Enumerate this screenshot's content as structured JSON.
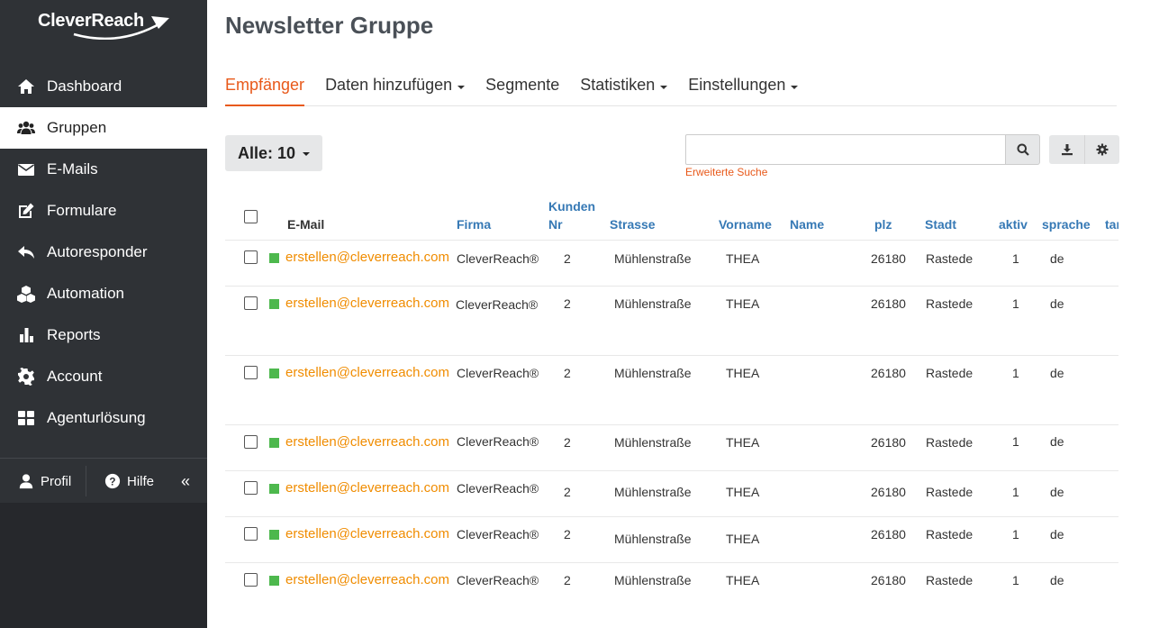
{
  "app": {
    "logo_text": "CleverReach"
  },
  "sidebar": {
    "items": [
      {
        "label": "Dashboard",
        "icon": "home-icon"
      },
      {
        "label": "Gruppen",
        "icon": "users-icon",
        "active": true
      },
      {
        "label": "E-Mails",
        "icon": "envelope-icon"
      },
      {
        "label": "Formulare",
        "icon": "edit-icon"
      },
      {
        "label": "Autoresponder",
        "icon": "reply-icon"
      },
      {
        "label": "Automation",
        "icon": "cubes-icon"
      },
      {
        "label": "Reports",
        "icon": "bar-chart-icon"
      },
      {
        "label": "Account",
        "icon": "gear-icon"
      },
      {
        "label": "Agenturlösung",
        "icon": "grid-icon"
      }
    ],
    "footer": {
      "profile_label": "Profil",
      "help_label": "Hilfe",
      "collapse_glyph": "«"
    }
  },
  "page": {
    "title": "Newsletter Gruppe"
  },
  "tabs": [
    {
      "label": "Empfänger",
      "active": true,
      "dropdown": false
    },
    {
      "label": "Daten hinzufügen",
      "dropdown": true
    },
    {
      "label": "Segmente",
      "dropdown": false
    },
    {
      "label": "Statistiken",
      "dropdown": true
    },
    {
      "label": "Einstellungen",
      "dropdown": true
    }
  ],
  "toolbar": {
    "filter_label": "Alle: 10",
    "search_value": "",
    "advanced_search_label": "Erweiterte Suche"
  },
  "table": {
    "headers": {
      "email": "E-Mail",
      "firma": "Firma",
      "kundennr_1": "Kunden",
      "kundennr_2": "Nr",
      "strasse": "Strasse",
      "vorname": "Vorname",
      "name": "Name",
      "plz": "plz",
      "stadt": "Stadt",
      "aktiv": "aktiv",
      "sprache": "sprache",
      "truncated": "tar"
    },
    "rows": [
      {
        "email": "erstellen@cleverreach.com",
        "firma": "CleverReach®",
        "kundennr": "2",
        "strasse": "Mühlenstraße",
        "vorname": "THEA",
        "name": "",
        "plz": "26180",
        "stadt": "Rastede",
        "aktiv": "1",
        "sprache": "de"
      },
      {
        "email": "erstellen@cleverreach.com",
        "firma": "CleverReach®",
        "kundennr": "2",
        "strasse": "Mühlenstraße",
        "vorname": "THEA",
        "name": "",
        "plz": "26180",
        "stadt": "Rastede",
        "aktiv": "1",
        "sprache": "de"
      },
      {
        "email": "erstellen@cleverreach.com",
        "firma": "CleverReach®",
        "kundennr": "2",
        "strasse": "Mühlenstraße",
        "vorname": "THEA",
        "name": "",
        "plz": "26180",
        "stadt": "Rastede",
        "aktiv": "1",
        "sprache": "de"
      },
      {
        "email": "erstellen@cleverreach.com",
        "firma": "CleverReach®",
        "kundennr": "2",
        "strasse": "Mühlenstraße",
        "vorname": "THEA",
        "name": "",
        "plz": "26180",
        "stadt": "Rastede",
        "aktiv": "1",
        "sprache": "de"
      },
      {
        "email": "erstellen@cleverreach.com",
        "firma": "CleverReach®",
        "kundennr": "2",
        "strasse": "Mühlenstraße",
        "vorname": "THEA",
        "name": "",
        "plz": "26180",
        "stadt": "Rastede",
        "aktiv": "1",
        "sprache": "de"
      },
      {
        "email": "erstellen@cleverreach.com",
        "firma": "CleverReach®",
        "kundennr": "2",
        "strasse": "Mühlenstraße",
        "vorname": "THEA",
        "name": "",
        "plz": "26180",
        "stadt": "Rastede",
        "aktiv": "1",
        "sprache": "de"
      },
      {
        "email": "erstellen@cleverreach.com",
        "firma": "CleverReach®",
        "kundennr": "2",
        "strasse": "Mühlenstraße",
        "vorname": "THEA",
        "name": "",
        "plz": "26180",
        "stadt": "Rastede",
        "aktiv": "1",
        "sprache": "de"
      }
    ]
  },
  "colors": {
    "accent": "#e8591a",
    "link": "#3679b5",
    "email": "#f08c00",
    "status_active": "#4db84d",
    "sidebar_bg": "#2f3236"
  }
}
